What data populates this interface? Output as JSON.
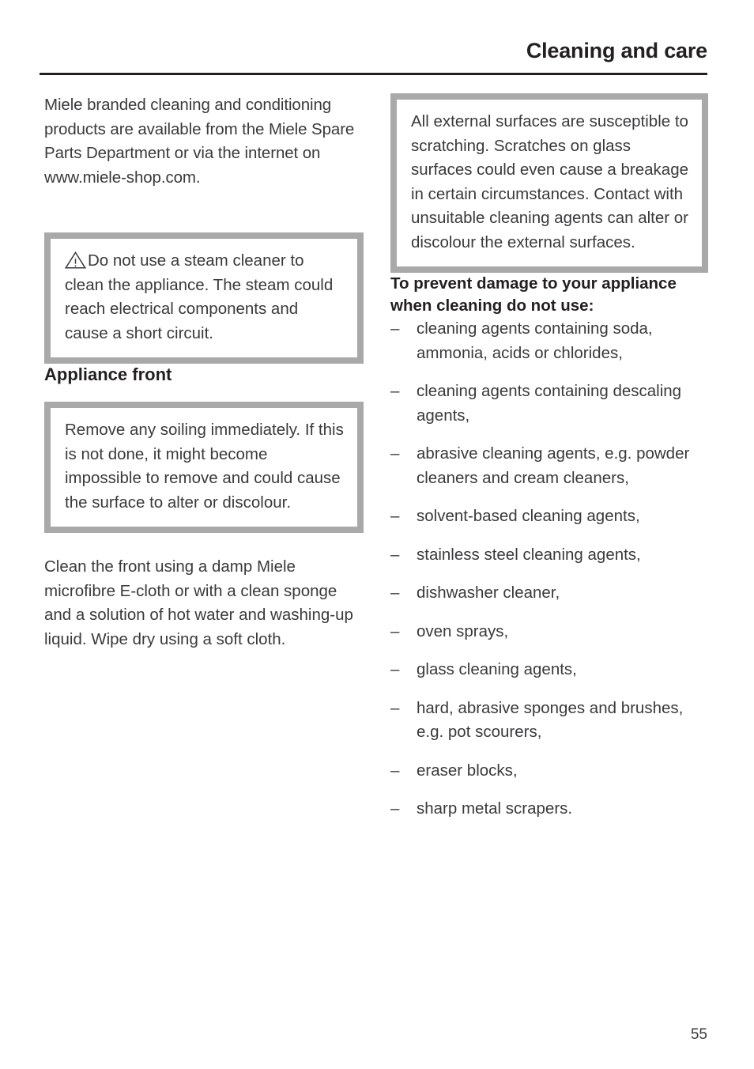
{
  "header": {
    "title": "Cleaning and care"
  },
  "left_column": {
    "intro_paragraph": "Miele branded cleaning and conditioning products are available from the Miele Spare Parts Department or via the internet on www.miele-shop.com.",
    "warning_box": {
      "icon": "warning-triangle-icon",
      "text": "Do not use a steam cleaner to clean the appliance. The steam could reach electrical components and cause a short circuit."
    },
    "section_heading": "Appliance front",
    "note_box": {
      "text": "Remove any soiling immediately. If this is not done, it might become impossible to remove and could cause the surface to alter or discolour."
    },
    "closing_paragraph": "Clean the front using a damp Miele microfibre E-cloth or with a clean sponge and a solution of hot water and washing-up liquid. Wipe dry using a soft cloth."
  },
  "right_column": {
    "note_box": {
      "text": "All external surfaces are susceptible to scratching. Scratches on glass surfaces could even cause a breakage in certain circumstances. Contact with unsuitable cleaning agents can alter or discolour the external surfaces."
    },
    "list_heading": "To prevent damage to your appliance when cleaning do not use:",
    "list_marker": "–",
    "items": [
      "cleaning agents containing soda, ammonia, acids or chlorides,",
      "cleaning agents containing descaling agents,",
      "abrasive cleaning agents, e.g. powder cleaners and cream cleaners,",
      "solvent-based cleaning agents,",
      "stainless steel cleaning agents,",
      "dishwasher cleaner,",
      "oven sprays,",
      "glass cleaning agents,",
      "hard, abrasive sponges and brushes, e.g. pot scourers,",
      "eraser blocks,",
      "sharp metal scrapers."
    ]
  },
  "footer": {
    "page_number": "55"
  },
  "colors": {
    "text": "#3a3a3c",
    "heading": "#231f20",
    "rule": "#231f20",
    "box_border": "#a9a9a9",
    "page_background": "#ffffff"
  }
}
